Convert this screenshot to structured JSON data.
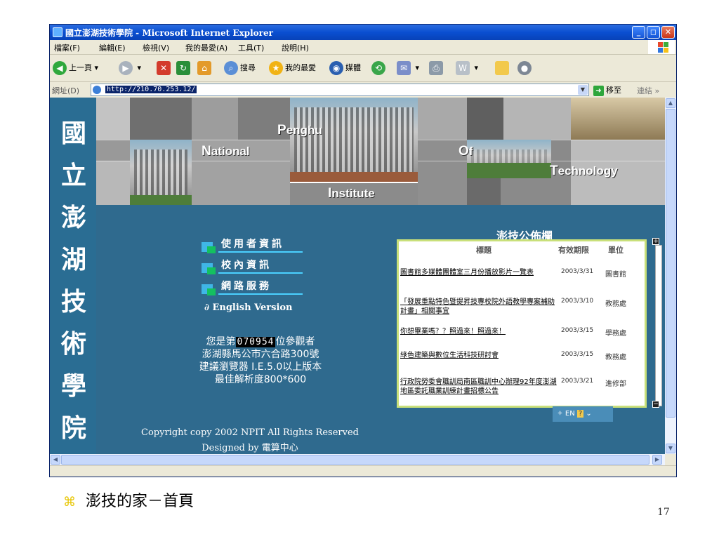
{
  "window": {
    "title": "國立澎湖技術學院 - Microsoft Internet Explorer",
    "controls": {
      "minimize": "_",
      "maximize": "◻",
      "close": "✕"
    }
  },
  "menu": [
    "檔案(F)",
    "編輯(E)",
    "檢視(V)",
    "我的最愛(A)",
    "工具(T)",
    "說明(H)"
  ],
  "toolbar": {
    "back": "上一頁",
    "search": "搜尋",
    "favorites": "我的最愛",
    "media": "媒體"
  },
  "address": {
    "label": "網址(D)",
    "url": "http://210.70.253.12/",
    "go": "移至",
    "links": "連結"
  },
  "site": {
    "side_title": [
      "國",
      "立",
      "澎",
      "湖",
      "技",
      "術",
      "學",
      "院"
    ],
    "banner_words": {
      "penghu": {
        "first": "P",
        "rest": "enghu"
      },
      "national": {
        "first": "N",
        "rest": "ational"
      },
      "of": {
        "first": "O",
        "rest": "f"
      },
      "technology": {
        "first": "T",
        "rest": "echnology"
      },
      "institute": {
        "first": "I",
        "rest": "nstitute"
      }
    },
    "nav": [
      "使用者資訊",
      "校內資訊",
      "網路服務"
    ],
    "english": "English Version",
    "visitor_prefix": "您是第",
    "visitor_count": "070954",
    "visitor_suffix": "位參觀者",
    "address_line": "澎湖縣馬公市六合路300號",
    "browser_line": "建議瀏覽器 I.E.5.0以上版本",
    "resolution_line": "最佳解析度800*600",
    "copyright": "Copyright copy 2002 NPIT All Rights Reserved",
    "designed": "Designed by 電算中心"
  },
  "bulletin": {
    "title": "澎技公佈欄",
    "headers": {
      "title": "標題",
      "expiry": "有效期限",
      "unit": "單位"
    },
    "rows": [
      {
        "title": "圖書館多媒體團體室三月份播放影片一覽表",
        "date": "2003/3/31",
        "unit": "圖書館"
      },
      {
        "title": "「發展重點特色暨提昇技專校院外語教學專案補助計畫」相關事宜",
        "date": "2003/3/10",
        "unit": "教務處"
      },
      {
        "title": "你想畢業嗎？？照過來！照過來！",
        "date": "2003/3/15",
        "unit": "學務處"
      },
      {
        "title": "綠色建築與數位生活科技研討會",
        "date": "2003/3/15",
        "unit": "教務處"
      },
      {
        "title": "行政院勞委會職訓局南區職訓中心辦理92年度澎湖地區委託職業訓練計畫招標公告",
        "date": "2003/3/21",
        "unit": "進修部"
      }
    ],
    "lang": "EN"
  },
  "slide": {
    "caption": "澎技的家－首頁",
    "page": "17"
  }
}
